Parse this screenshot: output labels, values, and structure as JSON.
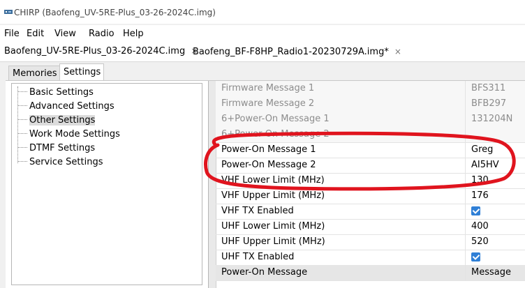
{
  "window": {
    "title": "CHIRP (Baofeng_UV-5RE-Plus_03-26-2024C.img)",
    "icon": "radio-icon"
  },
  "menu": [
    "File",
    "Edit",
    "View",
    "Radio",
    "Help"
  ],
  "doc_tabs": [
    {
      "label": "Baofeng_UV-5RE-Plus_03-26-2024C.img",
      "close": "×",
      "active": true
    },
    {
      "label": "Baofeng_BF-F8HP_Radio1-20230729A.img*",
      "close": "×",
      "active": false
    }
  ],
  "sub_tabs": [
    {
      "label": "Memories",
      "active": false
    },
    {
      "label": "Settings",
      "active": true
    }
  ],
  "tree": [
    {
      "label": "Basic Settings",
      "selected": false
    },
    {
      "label": "Advanced Settings",
      "selected": false
    },
    {
      "label": "Other Settings",
      "selected": true
    },
    {
      "label": "Work Mode Settings",
      "selected": false
    },
    {
      "label": "DTMF Settings",
      "selected": false
    },
    {
      "label": "Service Settings",
      "selected": false
    }
  ],
  "settings": [
    {
      "name": "Firmware Message 1",
      "value": "BFS311",
      "readonly": true
    },
    {
      "name": "Firmware Message 2",
      "value": "BFB297",
      "readonly": true
    },
    {
      "name": "6+Power-On Message 1",
      "value": "131204N",
      "readonly": true
    },
    {
      "name": "6+Power-On Message 2",
      "value": "",
      "readonly": true
    },
    {
      "name": "Power-On Message 1",
      "value": "Greg",
      "readonly": false
    },
    {
      "name": "Power-On Message 2",
      "value": "AI5HV",
      "readonly": false
    },
    {
      "name": "VHF Lower Limit (MHz)",
      "value": "130",
      "readonly": false
    },
    {
      "name": "VHF Upper Limit (MHz)",
      "value": "176",
      "readonly": false
    },
    {
      "name": "VHF TX Enabled",
      "checked": true,
      "readonly": false
    },
    {
      "name": "UHF Lower Limit (MHz)",
      "value": "400",
      "readonly": false
    },
    {
      "name": "UHF Upper Limit (MHz)",
      "value": "520",
      "readonly": false
    },
    {
      "name": "UHF TX Enabled",
      "checked": true,
      "readonly": false
    },
    {
      "name": "Power-On Message",
      "value": "Message",
      "readonly": false
    }
  ],
  "annotation": {
    "shape": "hand-drawn-ellipse",
    "color": "#e0141e"
  },
  "colors": {
    "checkbox": "#2f7fd6",
    "annotation": "#e0141e"
  }
}
